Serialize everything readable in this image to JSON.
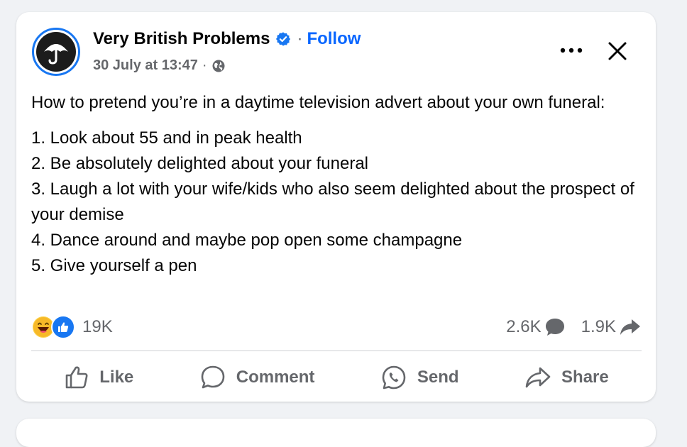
{
  "post": {
    "page_name": "Very British Problems",
    "follow_label": "Follow",
    "separator": "·",
    "timestamp": "30 July at 13:47",
    "meta_separator": "·",
    "intro": "How to pretend you’re in a daytime television advert about your own funeral:",
    "list_items": [
      "1. Look about 55 and in peak health",
      "2. Be absolutely delighted about your funeral",
      "3. Laugh a lot with your wife/kids who also seem delighted about the prospect of your demise",
      "4. Dance around and maybe pop open some champagne",
      "5. Give yourself a pen"
    ]
  },
  "stats": {
    "reaction_count": "19K",
    "comment_count": "2.6K",
    "share_count": "1.9K",
    "reaction_icons": [
      "laughing-emoji",
      "like-thumb"
    ]
  },
  "actions": {
    "like": "Like",
    "comment": "Comment",
    "send": "Send",
    "share": "Share"
  },
  "colors": {
    "follow_blue": "#0866ff",
    "verified_blue": "#1877f2",
    "muted_gray": "#65676b",
    "background": "#f0f2f5"
  },
  "icons": [
    "umbrella-logo",
    "verified-badge",
    "globe-icon",
    "more-icon",
    "close-icon",
    "comment-bubble-icon",
    "share-arrow-icon",
    "like-icon",
    "comment-icon",
    "send-icon",
    "share-icon"
  ]
}
